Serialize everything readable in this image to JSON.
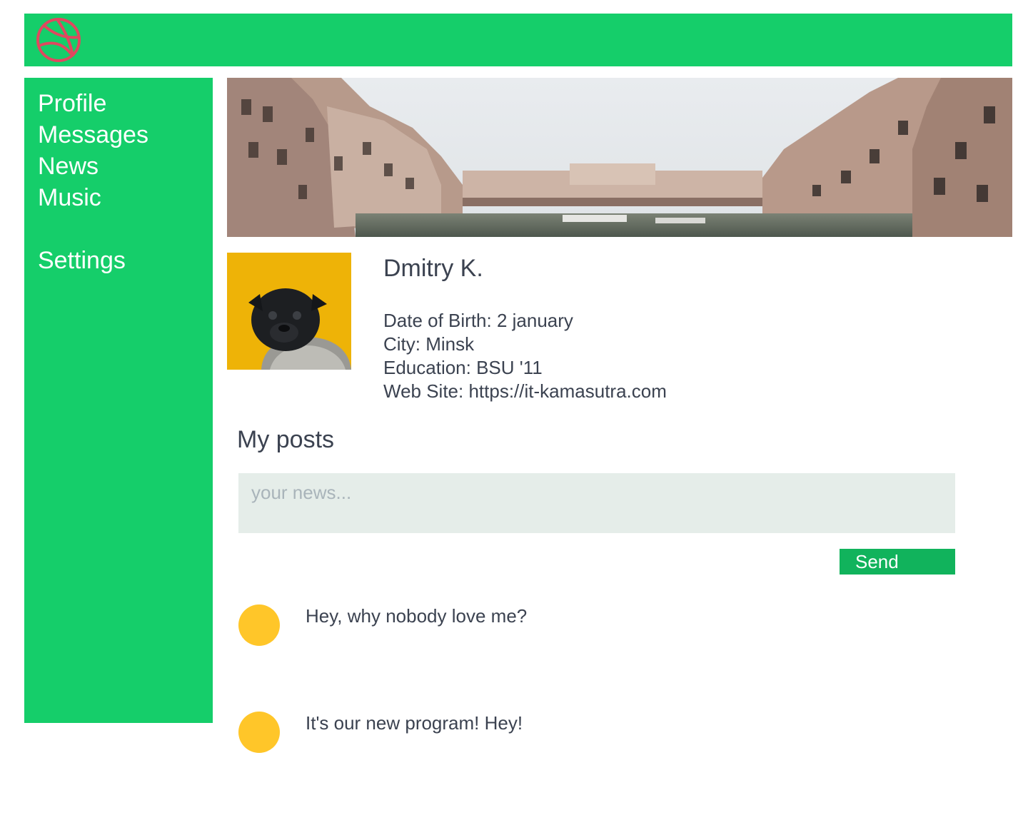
{
  "colors": {
    "accent": "#15ce6a",
    "send_button": "#11b35c",
    "logo": "#e0485f",
    "post_avatar": "#ffc629",
    "avatar_background": "#eeb307",
    "text": "#3b4250"
  },
  "header": {
    "logo_icon": "dribbble-ball-icon"
  },
  "nav": {
    "items": [
      {
        "label": "Profile"
      },
      {
        "label": "Messages"
      },
      {
        "label": "News"
      },
      {
        "label": "Music"
      }
    ],
    "settings": {
      "label": "Settings"
    }
  },
  "profile": {
    "name": "Dmitry K.",
    "date_of_birth": "Date of Birth: 2 january",
    "city": "City: Minsk",
    "education": "Education: BSU '11",
    "web_site": "Web Site: https://it-kamasutra.com"
  },
  "posts": {
    "title": "My posts",
    "input_placeholder": "your news...",
    "send_label": "Send",
    "items": [
      {
        "text": "Hey, why nobody love me?"
      },
      {
        "text": "It's our new program! Hey!"
      }
    ]
  }
}
